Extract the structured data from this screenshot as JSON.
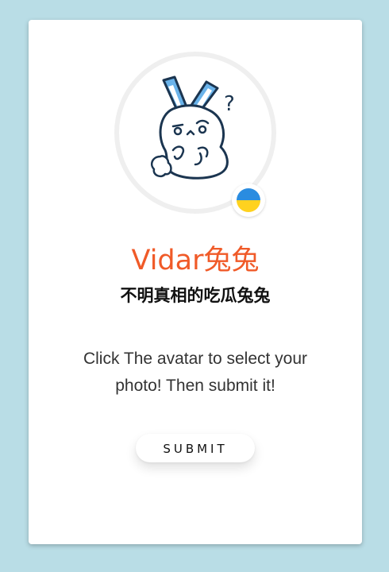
{
  "profile": {
    "name": "Vidar兔兔",
    "tagline": "不明真相的吃瓜兔兔"
  },
  "instruction": {
    "line1": "Click The avatar to select your",
    "line2": "photo! Then submit it!"
  },
  "actions": {
    "submit_label": "SUBMIT"
  },
  "avatar": {
    "icon": "confused-rabbit-icon",
    "question_mark": "?"
  },
  "badge": {
    "icon": "ukraine-flag-icon",
    "flag_colors": [
      "#2a8ce0",
      "#ffd21f"
    ]
  },
  "colors": {
    "background": "#b9dde6",
    "card": "#ffffff",
    "accent": "#f05a28",
    "text": "#111111",
    "ear_blue": "#6ab3ea",
    "line": "#1b3550"
  }
}
